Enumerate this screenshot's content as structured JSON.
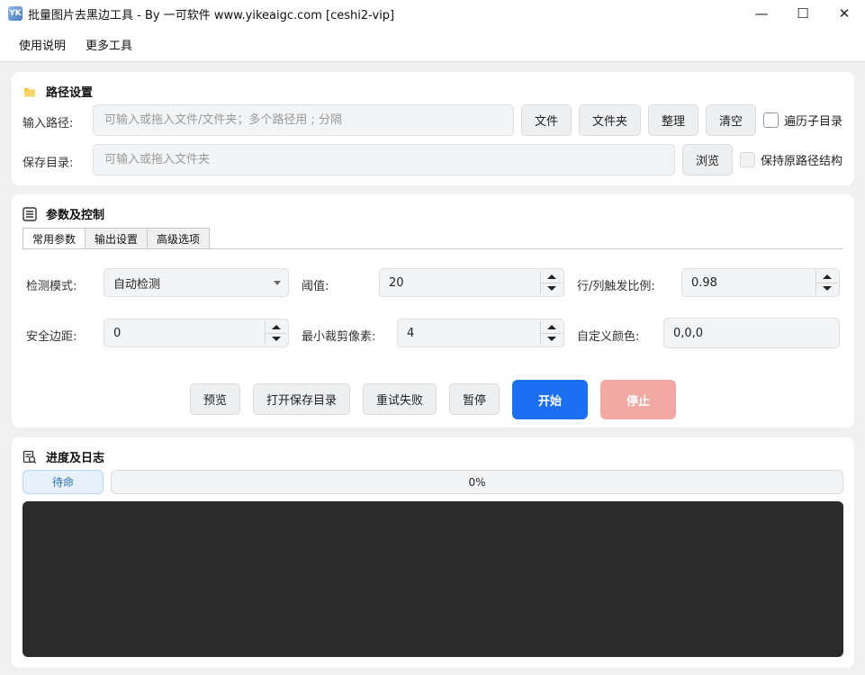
{
  "window": {
    "title": "批量图片去黑边工具 - By 一可软件 www.yikeaigc.com  [ceshi2-vip]",
    "icon_text": "YK",
    "minimize_glyph": "—",
    "maximize_glyph": "☐",
    "close_glyph": "✕"
  },
  "menu": {
    "items": [
      "使用说明",
      "更多工具"
    ]
  },
  "path_panel": {
    "title": "路径设置",
    "input_label": "输入路径:",
    "input_placeholder": "可输入或拖入文件/文件夹；多个路径用 ; 分隔",
    "input_value": "",
    "btn_file": "文件",
    "btn_folder": "文件夹",
    "btn_organize": "整理",
    "btn_clear": "清空",
    "recurse_label": "遍历子目录",
    "save_label": "保存目录:",
    "save_placeholder": "可输入或拖入文件夹",
    "save_value": "",
    "btn_browse": "浏览",
    "keep_structure_label": "保持原路径结构"
  },
  "params_panel": {
    "title": "参数及控制",
    "tabs": [
      "常用参数",
      "输出设置",
      "高级选项"
    ],
    "detect_mode_label": "检测模式:",
    "detect_mode_value": "自动检测",
    "threshold_label": "阈值:",
    "threshold_value": "20",
    "ratio_label": "行/列触发比例:",
    "ratio_value": "0.98",
    "margin_label": "安全边距:",
    "margin_value": "0",
    "min_crop_label": "最小裁剪像素:",
    "min_crop_value": "4",
    "custom_color_label": "自定义颜色:",
    "custom_color_value": "0,0,0",
    "btn_preview": "预览",
    "btn_open_save": "打开保存目录",
    "btn_retry": "重试失败",
    "btn_pause": "暂停",
    "btn_start": "开始",
    "btn_stop": "停止"
  },
  "progress_panel": {
    "title": "进度及日志",
    "status": "待命",
    "progress_text": "0%",
    "progress_value": 0
  },
  "colors": {
    "primary": "#1d6ff2",
    "danger_disabled": "#f2a9a4",
    "log_background": "#2b2b2b"
  }
}
